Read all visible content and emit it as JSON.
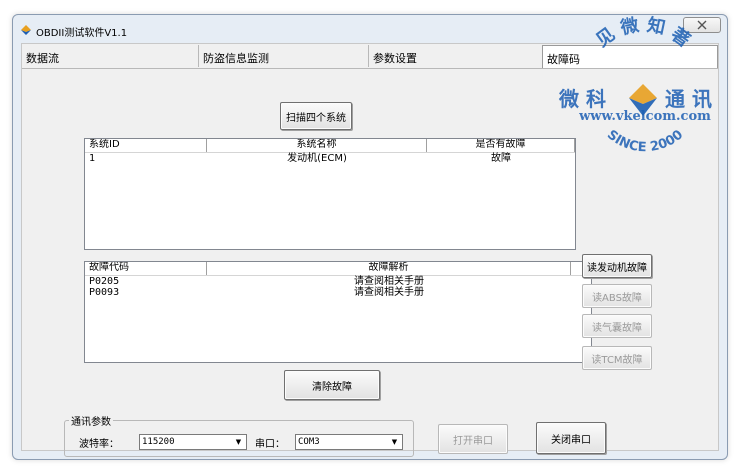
{
  "window": {
    "title": "OBDII测试软件V1.1",
    "close_icon": "close-icon"
  },
  "tabs": [
    {
      "label": "数据流",
      "active": false
    },
    {
      "label": "防盗信息监测",
      "active": false
    },
    {
      "label": "参数设置",
      "active": false
    },
    {
      "label": "故障码",
      "active": true
    }
  ],
  "fault_page": {
    "scan_button": "扫描四个系统",
    "systems_table": {
      "columns": [
        "系统ID",
        "系统名称",
        "是否有故障"
      ],
      "rows": [
        [
          "1",
          "发动机(ECM)",
          "故障"
        ]
      ]
    },
    "codes_table": {
      "columns": [
        "故障代码",
        "故障解析"
      ],
      "rows": [
        [
          "P0205",
          "请查阅相关手册"
        ],
        [
          "P0093",
          "请查阅相关手册"
        ]
      ]
    },
    "read_buttons": [
      {
        "label": "读发动机故障",
        "enabled": true
      },
      {
        "label": "读ABS故障",
        "enabled": false
      },
      {
        "label": "读气囊故障",
        "enabled": false
      },
      {
        "label": "读TCM故障",
        "enabled": false
      }
    ],
    "clear_button": "清除故障"
  },
  "comm": {
    "group_title": "通讯参数",
    "baud_label": "波特率：",
    "baud_value": "115200",
    "port_label": "串口：",
    "port_value": "COM3",
    "open_button": "打开串口",
    "open_enabled": false,
    "close_button": "关闭串口"
  },
  "watermark": {
    "top_text": "见 微 知 著",
    "left_text": "微 科",
    "right_text": "通 讯",
    "url": "www.vkelcom.com",
    "since": "SINCE 2000"
  },
  "colors": {
    "window_frame": "#e6edf5",
    "client_bg": "#f0f0f0",
    "watermark_blue": "#1d5fb3",
    "logo_orange": "#e8a020"
  }
}
